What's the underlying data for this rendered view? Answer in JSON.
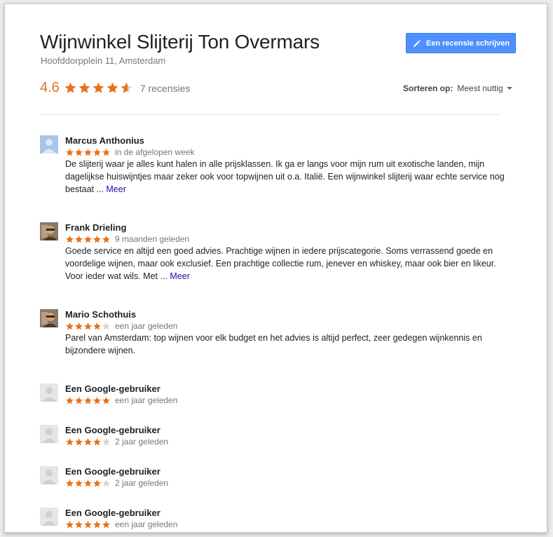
{
  "place": {
    "title": "Wijnwinkel Slijterij Ton Overmars",
    "address": "Hoofddorpplein 11, Amsterdam"
  },
  "write_button": {
    "label": "Een recensie schrijven",
    "icon": "pencil-icon"
  },
  "summary": {
    "rating": "4.6",
    "stars": 4.6,
    "review_count": "7 recensies"
  },
  "sort": {
    "label": "Sorteren op:",
    "value": "Meest nuttig"
  },
  "colors": {
    "star": "#e7711b",
    "star_empty": "#d5d5d5",
    "button": "#4d90fe",
    "link": "#1a0dab"
  },
  "reviews": [
    {
      "author": "Marcus Anthonius",
      "stars": 5,
      "date": "in de afgelopen week",
      "text": "De slijterij waar je alles kunt halen in alle prijsklassen. Ik ga er langs voor mijn rum uit exotische landen, mijn dagelijkse huiswijntjes maar zeker ook voor topwijnen uit o.a. Italië. Een wijnwinkel slijterij waar echte service nog bestaat ...",
      "more": "Meer",
      "avatar": "default-avatar-blue"
    },
    {
      "author": "Frank Drieling",
      "stars": 5,
      "date": "9 maanden geleden",
      "text": "Goede service en altijd een goed advies. Prachtige wijnen in iedere prijscategorie. Soms verrassend goede en voordelige wijnen, maar ook exclusief. Een prachtige collectie rum, jenever en whiskey, maar ook bier en likeur. Voor ieder wat wils. Met ...",
      "more": "Meer",
      "avatar": "photo-avatar"
    },
    {
      "author": "Mario Schothuis",
      "stars": 4,
      "date": "een jaar geleden",
      "text": "Parel van Amsterdam: top wijnen voor elk budget en het advies is altijd perfect, zeer gedegen wijnkennis en bijzondere wijnen.",
      "more": "",
      "avatar": "photo-avatar"
    },
    {
      "author": "Een Google-gebruiker",
      "stars": 5,
      "date": "een jaar geleden",
      "text": "",
      "more": "",
      "avatar": "default-avatar-grey"
    },
    {
      "author": "Een Google-gebruiker",
      "stars": 4,
      "date": "2 jaar geleden",
      "text": "",
      "more": "",
      "avatar": "default-avatar-grey"
    },
    {
      "author": "Een Google-gebruiker",
      "stars": 4,
      "date": "2 jaar geleden",
      "text": "",
      "more": "",
      "avatar": "default-avatar-grey"
    },
    {
      "author": "Een Google-gebruiker",
      "stars": 5,
      "date": "een jaar geleden",
      "text": "",
      "more": "",
      "avatar": "default-avatar-grey"
    }
  ]
}
